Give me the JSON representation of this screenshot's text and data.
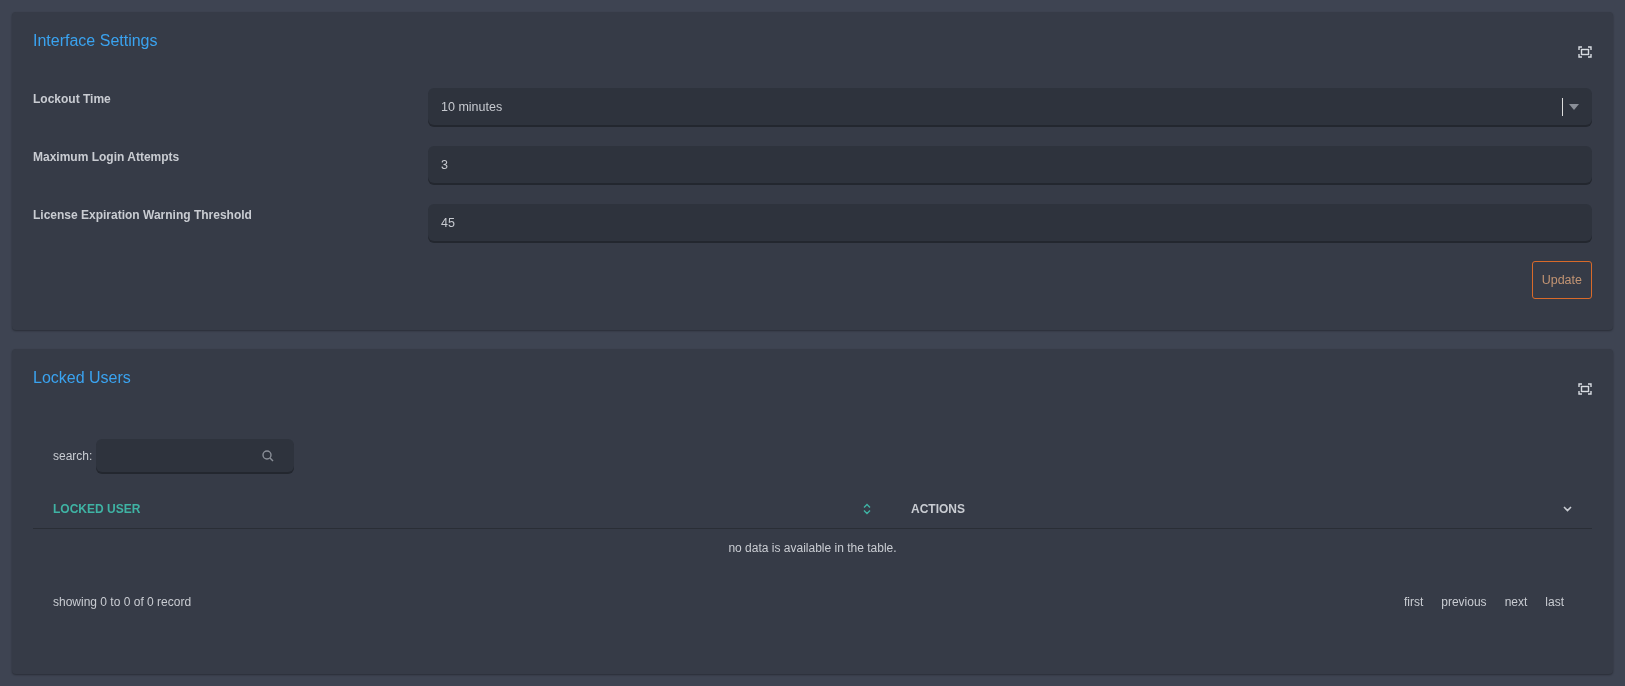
{
  "interface_settings": {
    "title": "Interface Settings",
    "fields": [
      {
        "label": "Lockout Time",
        "kind": "dropdown",
        "value": "10 minutes"
      },
      {
        "label": "Maximum Login Attempts",
        "kind": "text",
        "value": "3"
      },
      {
        "label": "License Expiration Warning Threshold",
        "kind": "text",
        "value": "45"
      }
    ],
    "update_button": "Update"
  },
  "locked_users": {
    "title": "Locked Users",
    "search_label": "search:",
    "table": {
      "columns": [
        {
          "label": "LOCKED USER",
          "sorted": true
        },
        {
          "label": "ACTIONS",
          "sorted": false
        }
      ],
      "empty_message": "no data is available in the table."
    },
    "footer": "showing 0 to 0 of 0 record",
    "pagination": [
      "first",
      "previous",
      "next",
      "last"
    ]
  }
}
